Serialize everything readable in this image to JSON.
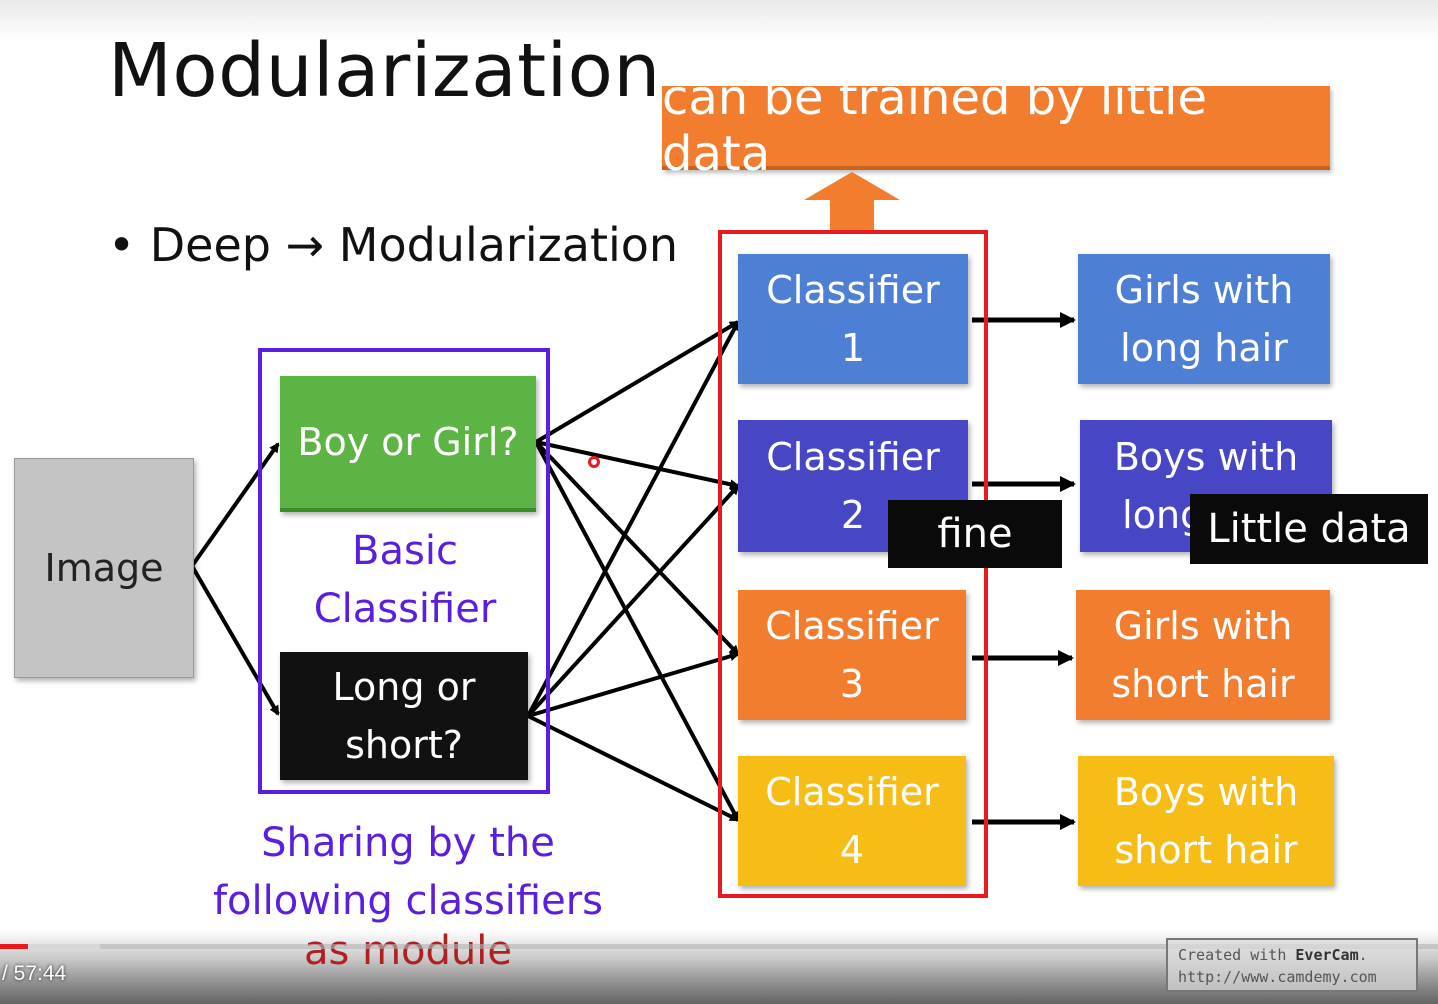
{
  "slide": {
    "title": "Modularization",
    "bullet": "• Deep → Modularization",
    "banner": "can be trained by little data",
    "input_box": "Image",
    "basic_classifiers": {
      "top": "Boy or Girl?",
      "bottom": "Long or\nshort?",
      "label": "Basic\nClassifier",
      "caption_lines": [
        "Sharing by the",
        "following classifiers",
        "as module"
      ]
    },
    "classifiers": [
      {
        "label": "Classifier\n1"
      },
      {
        "label": "Classifier\n2"
      },
      {
        "label": "Classifier\n3"
      },
      {
        "label": "Classifier\n4"
      }
    ],
    "outputs": [
      {
        "label": "Girls with\nlong hair"
      },
      {
        "label": "Boys with\nlong hair"
      },
      {
        "label": "Girls with\nshort hair"
      },
      {
        "label": "Boys with\nshort hair"
      }
    ]
  },
  "subtitles": [
    "fine",
    "Little data"
  ],
  "player": {
    "timecode": "/ 57:44",
    "progress_fraction": 0.02,
    "buffered_fraction": 0.07
  },
  "watermark": {
    "line1_prefix": "Created with ",
    "line1_brand": "EverCam",
    "line1_suffix": ".",
    "line2": "http://www.camdemy.com"
  },
  "colors": {
    "banner": "#f27d2e",
    "purple_frame": "#5a1ee0",
    "red_frame": "#e8191f",
    "classifier_1": "#4d7fd4",
    "classifier_2": "#4746c4",
    "classifier_3": "#f27d2e",
    "classifier_4": "#f6bd17"
  }
}
